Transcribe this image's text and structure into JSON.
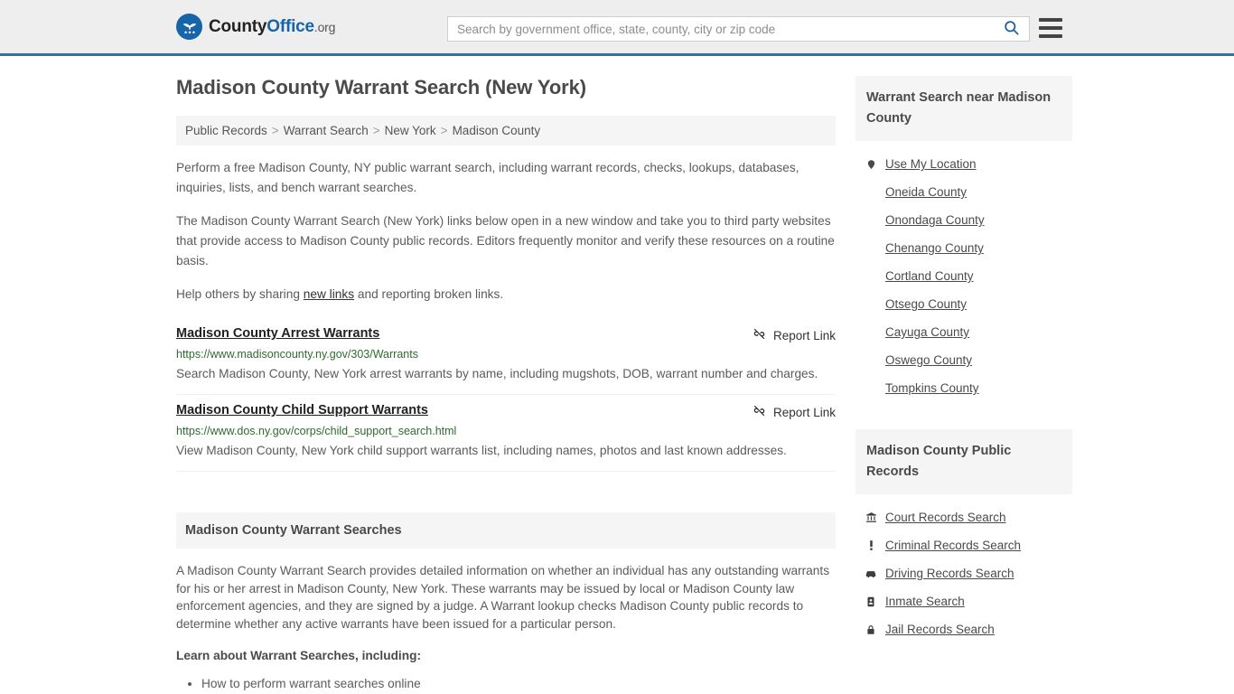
{
  "header": {
    "logo": {
      "icon": "eagle-seal-icon",
      "text_county": "County",
      "text_office": "Office",
      "text_tld": ".org"
    },
    "search": {
      "placeholder": "Search by government office, state, county, city or zip code",
      "value": "",
      "icon": "search-icon"
    },
    "menu": {
      "icon": "hamburger-menu-icon"
    },
    "accent_color": "#35709e",
    "background_color": "#eeeeee"
  },
  "main": {
    "title": "Madison County Warrant Search (New York)",
    "breadcrumb": [
      {
        "label": "Public Records"
      },
      {
        "label": "Warrant Search"
      },
      {
        "label": "New York"
      },
      {
        "label": "Madison County"
      }
    ],
    "breadcrumb_separator": ">",
    "paragraphs": {
      "p1": "Perform a free Madison County, NY public warrant search, including warrant records, checks, lookups, databases, inquiries, lists, and bench warrant searches.",
      "p2": "The Madison County Warrant Search (New York) links below open in a new window and take you to third party websites that provide access to Madison County public records. Editors frequently monitor and verify these resources on a routine basis.",
      "p3_before": "Help others by sharing ",
      "p3_link": "new links",
      "p3_after": " and reporting broken links."
    },
    "report_link_label": "Report Link",
    "report_link_icon": "broken-link-icon",
    "results": [
      {
        "title": "Madison County Arrest Warrants",
        "url": "https://www.madisoncounty.ny.gov/303/Warrants",
        "description": "Search Madison County, New York arrest warrants by name, including mugshots, DOB, warrant number and charges."
      },
      {
        "title": "Madison County Child Support Warrants",
        "url": "https://www.dos.ny.gov/corps/child_support_search.html",
        "description": "View Madison County, New York child support warrants list, including names, photos and last known addresses."
      }
    ],
    "section": {
      "heading": "Madison County Warrant Searches",
      "body": "A Madison County Warrant Search provides detailed information on whether an individual has any outstanding warrants for his or her arrest in Madison County, New York. These warrants may be issued by local or Madison County law enforcement agencies, and they are signed by a judge. A Warrant lookup checks Madison County public records to determine whether any active warrants have been issued for a particular person.",
      "learn_label": "Learn about Warrant Searches, including:",
      "bullets": [
        "How to perform warrant searches online"
      ]
    }
  },
  "sidebar": {
    "nearby": {
      "heading": "Warrant Search near Madison County",
      "items": [
        {
          "label": "Use My Location",
          "icon": "map-pin-icon"
        },
        {
          "label": "Oneida County",
          "icon": ""
        },
        {
          "label": "Onondaga County",
          "icon": ""
        },
        {
          "label": "Chenango County",
          "icon": ""
        },
        {
          "label": "Cortland County",
          "icon": ""
        },
        {
          "label": "Otsego County",
          "icon": ""
        },
        {
          "label": "Cayuga County",
          "icon": ""
        },
        {
          "label": "Oswego County",
          "icon": ""
        },
        {
          "label": "Tompkins County",
          "icon": ""
        }
      ]
    },
    "records": {
      "heading": "Madison County Public Records",
      "items": [
        {
          "label": "Court Records Search",
          "icon": "courthouse-icon"
        },
        {
          "label": "Criminal Records Search",
          "icon": "exclamation-icon"
        },
        {
          "label": "Driving Records Search",
          "icon": "car-icon"
        },
        {
          "label": "Inmate Search",
          "icon": "id-badge-icon"
        },
        {
          "label": "Jail Records Search",
          "icon": "lock-icon"
        }
      ]
    }
  }
}
